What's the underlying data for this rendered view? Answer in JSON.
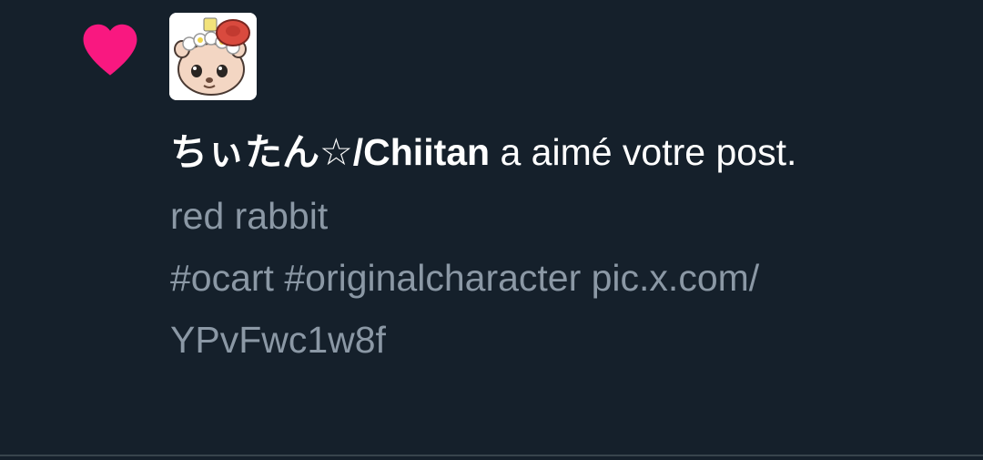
{
  "notification": {
    "icon": "heart-icon",
    "icon_color": "#f91880",
    "avatar": "user-avatar-chiitan",
    "user_name": "ちぃたん☆/Chiitan",
    "action_text": " a aimé votre post.",
    "post_lines": [
      "red rabbit",
      "#ocart #originalcharacter pic.x.com/",
      "YPvFwc1w8f"
    ]
  },
  "colors": {
    "background": "#15202b",
    "primary_text": "#ffffff",
    "secondary_text": "#8b98a5",
    "divider": "#38444d"
  }
}
